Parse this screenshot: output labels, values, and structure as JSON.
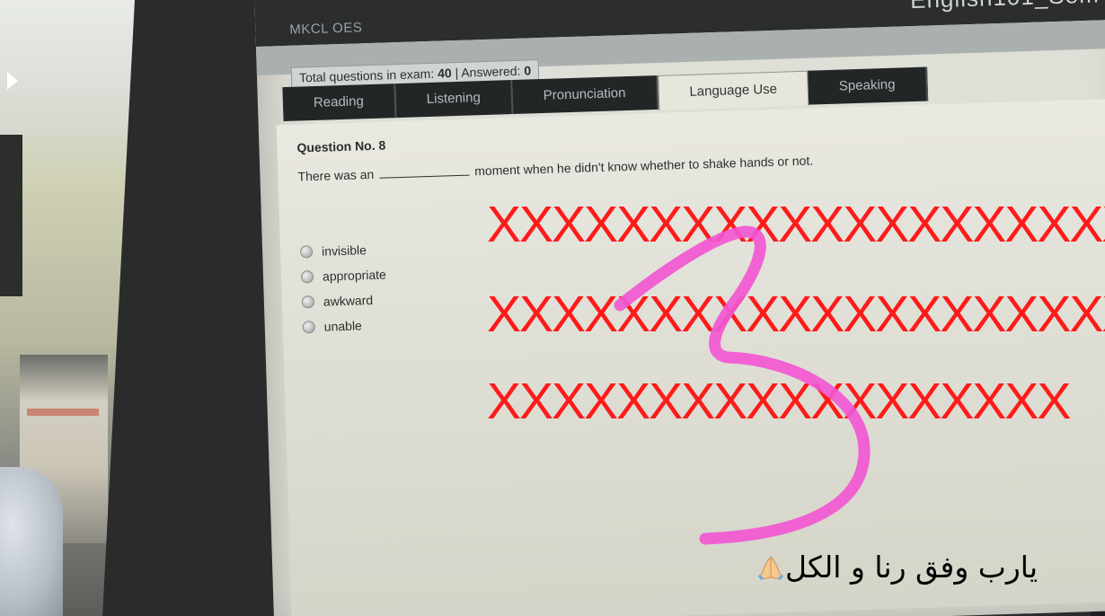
{
  "app": {
    "brand": "MKCL OES",
    "exam_title": "English101_Sem"
  },
  "status": {
    "label_total": "Total questions in exam:",
    "total": "40",
    "separator": "|",
    "label_answered": "Answered:",
    "answered": "0"
  },
  "tabs": [
    {
      "label": "Reading"
    },
    {
      "label": "Listening"
    },
    {
      "label": "Pronunciation"
    },
    {
      "label": "Language Use"
    },
    {
      "label": "Speaking"
    }
  ],
  "active_tab": "Language Use",
  "question": {
    "number_label": "Question No. 8",
    "text_before": "There was an",
    "text_after": "moment when he didn't know whether to shake hands or not.",
    "options": [
      {
        "label": "invisible"
      },
      {
        "label": "appropriate"
      },
      {
        "label": "awkward"
      },
      {
        "label": "unable"
      }
    ]
  },
  "overlay": {
    "x_rows": [
      "XXXXXXXXXXXXXXXXXXXX",
      "XXXXXXXXXXXXXXXXXXXX",
      "XXXXXXXXXXXXXXXXXX"
    ],
    "handwritten_digit": "3",
    "caption": "يارب وفق رنا و الكل",
    "colors": {
      "x_marks": "#ff1a1a",
      "scribble": "#f257d2"
    }
  }
}
